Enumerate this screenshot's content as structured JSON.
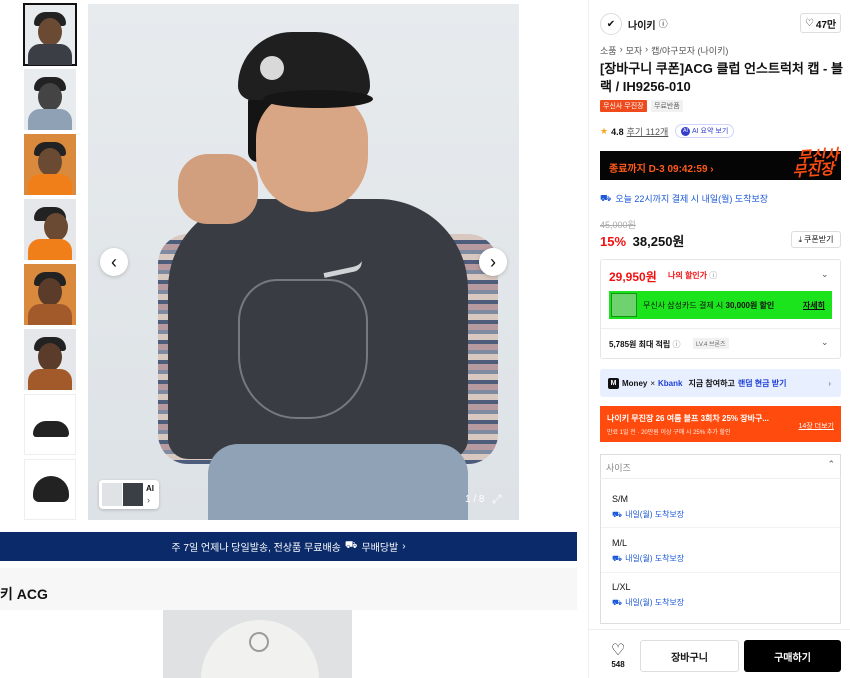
{
  "gallery": {
    "counter": "1 / 8",
    "ai_chip_label": "AI",
    "ai_chip_arrow": "›",
    "prev": "‹",
    "next": "›",
    "expand": "⤢"
  },
  "banner": {
    "text": "주 7일 언제나 당일발송, 전상품 무료배송",
    "badge": "무배당발",
    "arrow": "›"
  },
  "section_title": "키 ACG",
  "brand": {
    "name": "나이키",
    "info": "ⓘ",
    "likes": "47만"
  },
  "breadcrumb": [
    "소품",
    "모자",
    "캡/야구모자 (나이키)"
  ],
  "breadcrumb_sep": "›",
  "product": {
    "title": "[장바구니 쿠폰]ACG 클럽 언스트럭처 캡 - 블랙 / IH9256-010",
    "tag_primary": "무신사 무진장",
    "tag_secondary": "무료반품",
    "rating": "4.8",
    "reviews": "후기 112개",
    "ai_summary": "AI 요약 보기"
  },
  "promo": {
    "countdown": "종료까지 D-3 09:42:59",
    "arrow": "›",
    "logo_line1": "무신사",
    "logo_line2": "무진장"
  },
  "delivery": {
    "text": "오늘 22시까지 결제 시 내일(월) 도착보장"
  },
  "price": {
    "original": "45,000원",
    "discount": "15%",
    "sale": "38,250원",
    "coupon_button": "쿠폰받기"
  },
  "benefit": {
    "my_price": "29,950원",
    "my_price_label": "나의 할인가",
    "card_text_pre": "무신사 삼성카드 결제 시 ",
    "card_text_amount": "30,000원 할인",
    "card_detail": "자세히",
    "points": "5,785원 최대 적립",
    "level": "LV.4 브론즈"
  },
  "money_bar": {
    "m_icon": "M",
    "money": "Money",
    "x": "×",
    "kbank": "Kbank",
    "text": "지금 참여하고",
    "highlight": "랜덤 현금 받기",
    "arrow": "›"
  },
  "event_bar": {
    "title": "나이키 무진장 26 여름 블프 3회차 25% 장바구...",
    "subtitle": "만료 1일 전 · 20만원 이상 구매 시 25% 추가 할인",
    "more": "14장 더보기"
  },
  "size": {
    "header": "사이즈",
    "options": [
      {
        "label": "S/M",
        "delivery": "내일(월) 도착보장"
      },
      {
        "label": "M/L",
        "delivery": "내일(월) 도착보장"
      },
      {
        "label": "L/XL",
        "delivery": "내일(월) 도착보장"
      }
    ]
  },
  "actions": {
    "like_count": "548",
    "cart": "장바구니",
    "buy": "구매하기"
  },
  "colors": {
    "accent_red": "#f31110",
    "orange": "#ff4b0d",
    "blue": "#1d5ad8",
    "navy_banner": "#0a2a6a",
    "green_card": "#1ce41c"
  }
}
